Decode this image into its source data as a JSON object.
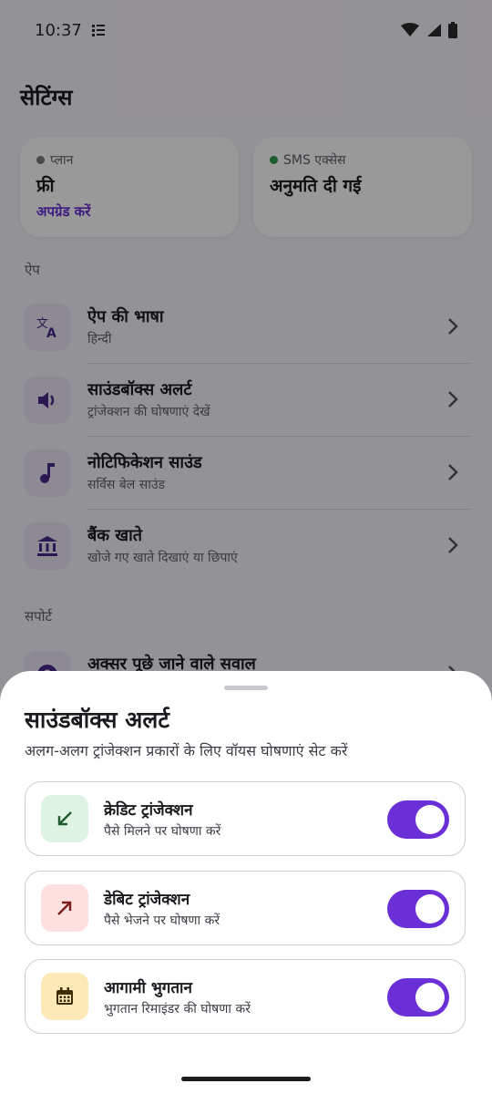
{
  "status_bar": {
    "time": "10:37"
  },
  "screen": {
    "title": "सेटिंग्स",
    "cards": [
      {
        "caption": "प्लान",
        "value": "फ्री",
        "link": "अपग्रेड करें",
        "dot_color": "#7a7a7a"
      },
      {
        "caption": "SMS एक्सेस",
        "value": "अनुमति दी गई",
        "dot_color": "#2e9c4f"
      }
    ],
    "section_app": "ऐप",
    "rows": [
      {
        "title": "ऐप की भाषा",
        "subtitle": "हिन्दी",
        "icon": "translate-icon"
      },
      {
        "title": "साउंडबॉक्स अलर्ट",
        "subtitle": "ट्रांजेक्शन की घोषणाएं देखें",
        "icon": "volume-icon"
      },
      {
        "title": "नोटिफिकेशन साउंड",
        "subtitle": "सर्विस बेल साउंड",
        "icon": "music-note-icon"
      },
      {
        "title": "बैंक खाते",
        "subtitle": "खोजे गए खाते दिखाएं या छिपाएं",
        "icon": "bank-icon"
      }
    ],
    "section_support": "सपोर्ट",
    "faq_row": {
      "title": "अक्सर पूछे जाने वाले सवाल"
    }
  },
  "sheet": {
    "title": "साउंडबॉक्स अलर्ट",
    "subtitle": "अलग-अलग ट्रांजेक्शन प्रकारों के लिए वॉयस घोषणाएं सेट करें",
    "options": [
      {
        "title": "क्रेडिट ट्रांजेक्शन",
        "subtitle": "पैसे मिलने पर घोषणा करें",
        "icon": "arrow-down-left-icon",
        "icon_bg": "#dff3e4",
        "icon_color": "#1f5c2e",
        "enabled": true
      },
      {
        "title": "डेबिट ट्रांजेक्शन",
        "subtitle": "पैसे भेजने पर घोषणा करें",
        "icon": "arrow-up-right-icon",
        "icon_bg": "#fde0df",
        "icon_color": "#7a1f1f",
        "enabled": true
      },
      {
        "title": "आगामी भुगतान",
        "subtitle": "भुगतान रिमाइंडर की घोषणा करें",
        "icon": "calendar-icon",
        "icon_bg": "#fde9b8",
        "icon_color": "#3d2c00",
        "enabled": true
      }
    ],
    "accent_color": "#6a2fd6"
  }
}
